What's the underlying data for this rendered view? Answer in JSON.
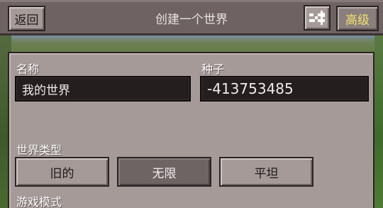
{
  "header": {
    "back_label": "返回",
    "title": "创建一个世界",
    "shuffle_icon": "shuffle-icon",
    "advanced_label": "高级"
  },
  "form": {
    "name_label": "名称",
    "name_value": "我的世界",
    "seed_label": "种子",
    "seed_value": "-413753485",
    "world_type_label": "世界类型",
    "world_types": [
      "旧的",
      "无限",
      "平坦"
    ],
    "selected_world_type": "无限",
    "game_mode_label": "游戏模式"
  },
  "colors": {
    "advanced_text": "#f2e26e",
    "panel": "#a69a98",
    "field_bg": "#241e1e"
  }
}
